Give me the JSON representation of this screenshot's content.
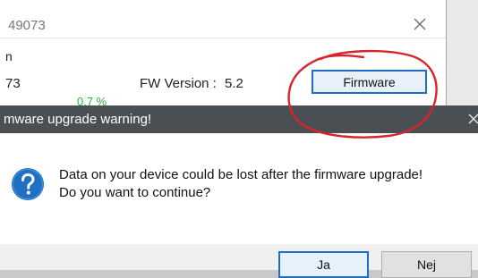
{
  "background_window": {
    "title": "49073",
    "section_label": "n",
    "device_id": "73",
    "fw_label": "FW Version :",
    "fw_value": "5.2",
    "progress": "0.7 %",
    "firmware_button": "Firmware",
    "close_icon": "close-icon"
  },
  "dialog": {
    "title": "mware upgrade warning!",
    "message_line1": "Data on your device could be lost after the firmware upgrade!",
    "message_line2": "Do you want to continue?",
    "icon": "question-icon",
    "yes_button": "Ja",
    "no_button": "Nej"
  },
  "annotation": {
    "color": "#d6262b"
  },
  "colors": {
    "accent": "#1e6fc4",
    "dialog_titlebar": "#4a4f54",
    "progress": "#25b83c"
  }
}
